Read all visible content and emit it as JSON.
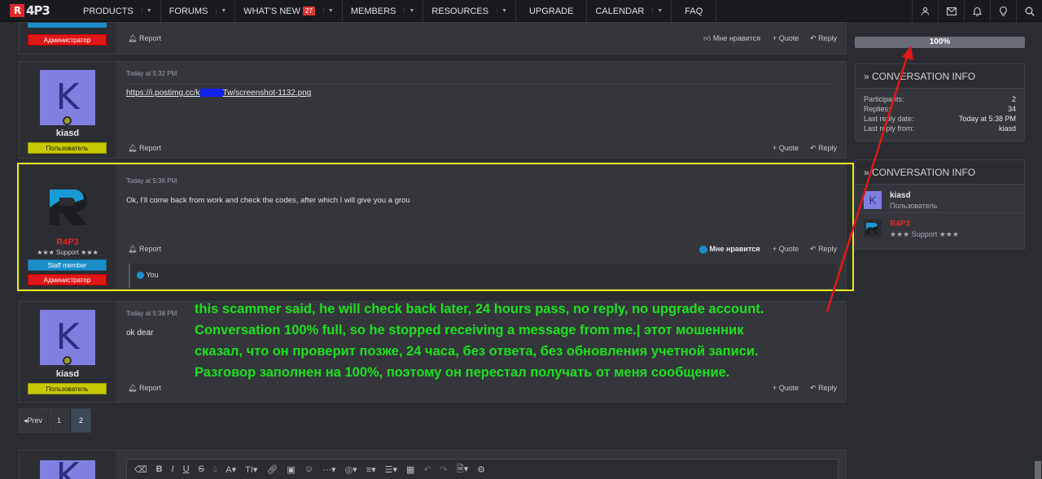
{
  "logo": "R4P3",
  "nav": [
    {
      "label": "PRODUCTS",
      "chev": true
    },
    {
      "label": "FORUMS",
      "chev": true
    },
    {
      "label": "WHAT'S NEW",
      "badge": "27",
      "chev": true
    },
    {
      "label": "MEMBERS",
      "chev": true
    },
    {
      "label": "RESOURCES",
      "chev": true
    },
    {
      "label": "UPGRADE",
      "chev": false
    },
    {
      "label": "CALENDAR",
      "chev": true
    },
    {
      "label": "FAQ",
      "chev": false
    }
  ],
  "nav_icons": [
    "user-icon",
    "mail-icon",
    "bell-icon",
    "bulb-icon",
    "search-icon"
  ],
  "actions": {
    "report": "Report",
    "like": "Мне нравится",
    "liked": "Мне нравится",
    "quote": "+ Quote",
    "reply": "Reply"
  },
  "posts": [
    {
      "role": "Администратор"
    },
    {
      "date": "Today at 5:32 PM",
      "avatar_letter": "K",
      "username": "kiasd",
      "role": "Пользователь",
      "link_pre": "https://i.postimg.cc/k",
      "link_post": "Tw/screenshot-1132.png"
    },
    {
      "date": "Today at 5:36 PM",
      "username": "R4P3",
      "title": "★★★ Support ★★★",
      "role1": "Staff member",
      "role2": "Администратор",
      "text": "Ok, I'll come back from work and check the codes, after which I will give you a grou",
      "reaction": "You"
    },
    {
      "date": "Today at 5:38 PM",
      "avatar_letter": "K",
      "username": "kiasd",
      "role": "Пользователь",
      "text": "ok dear"
    }
  ],
  "pager": {
    "prev": "Prev",
    "pages": [
      "1",
      "2"
    ],
    "current": "2"
  },
  "sidebar": {
    "progress_label": "100%",
    "progress_value": 1.0,
    "info_title": "» CONVERSATION INFO",
    "info_rows": [
      {
        "k": "Participants:",
        "v": "2"
      },
      {
        "k": "Replies:",
        "v": "34"
      },
      {
        "k": "Last reply date:",
        "v": "Today at 5:38 PM"
      },
      {
        "k": "Last reply from:",
        "v": "kiasd"
      }
    ],
    "members_title": "» CONVERSATION INFO",
    "members": [
      {
        "letter": "K",
        "name": "kiasd",
        "title": "Пользователь"
      },
      {
        "name": "R4P3",
        "title": "★★★ Support ★★★"
      }
    ]
  },
  "overlay_lines": [
    "this scammer said, he will check back later, 24 hours pass, no reply, no upgrade account.",
    "Conversation 100% full, so he stopped receiving a message from me.| этот мошенник",
    "сказал, что он проверит позже, 24 часа, без ответа, без обновления учетной записи.",
    "Разговор заполнен на 100%, поэтому он перестал получать от меня сообщение."
  ],
  "colors": {
    "annotation": "#1ee01e",
    "arrow": "#e01818",
    "highlight": "#ecec1e",
    "brand": "#e02828"
  }
}
